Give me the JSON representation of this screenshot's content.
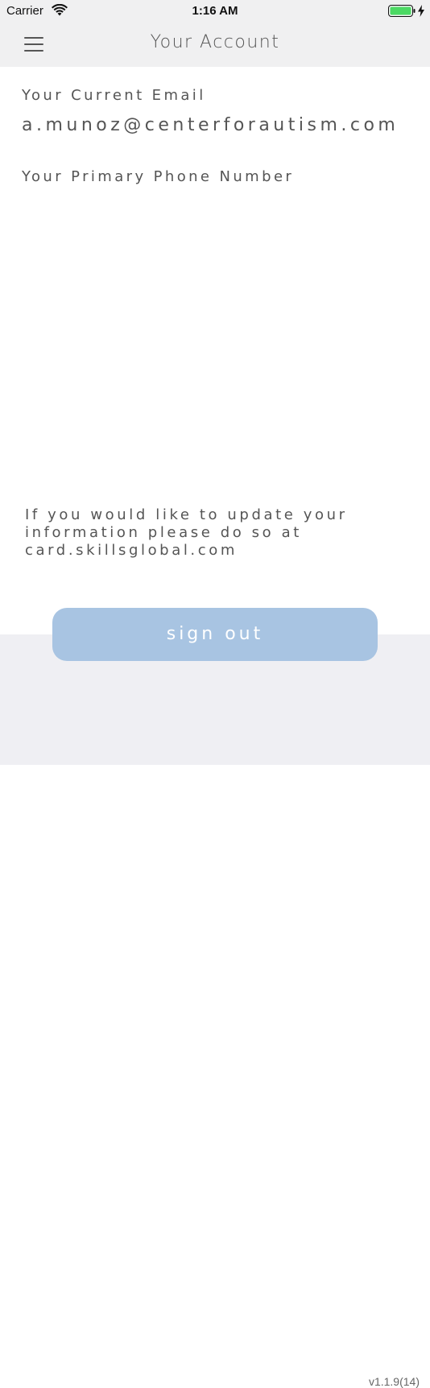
{
  "status_bar": {
    "carrier": "Carrier",
    "time": "1:16 AM",
    "wifi_icon": "wifi-icon",
    "battery_icon": "battery-charging-icon",
    "battery_color": "#4cd964"
  },
  "nav": {
    "title": "Your Account",
    "menu_icon": "hamburger-menu-icon"
  },
  "account": {
    "email_label": "Your Current Email",
    "email_value": "a.munoz@centerforautism.com",
    "phone_label": "Your Primary Phone Number"
  },
  "info": {
    "line1": "If you would like to update your",
    "line2": "information please do so at",
    "line3": "card.skillsglobal.com"
  },
  "actions": {
    "sign_out_label": "sign out",
    "sign_out_color": "#a8c4e2"
  },
  "footer": {
    "version": "v1.1.9(14)"
  }
}
